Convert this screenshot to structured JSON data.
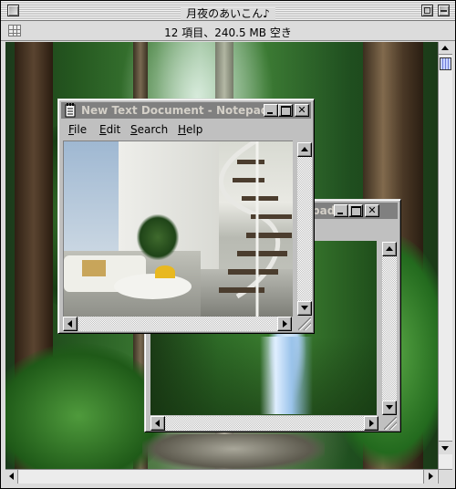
{
  "mac_window": {
    "title": "月夜のあいこん♪",
    "info": "12 項目、240.5 MB 空き"
  },
  "front_window": {
    "title": "New Text Document - Notepad",
    "menu": [
      "File",
      "Edit",
      "Search",
      "Help"
    ],
    "close_glyph": "✕"
  },
  "back_window": {
    "title_fragment": "pad",
    "close_glyph": "✕"
  },
  "icons": [
    "grid-icon",
    "notepad-icon",
    "minimize-icon",
    "maximize-icon",
    "close-icon",
    "scroll-arrow-icons",
    "resize-grip-icon"
  ],
  "colors": {
    "mac_chrome": "#dcdcdc",
    "win_chrome": "#c0c0c0",
    "inactive_titlebar": "#808080",
    "scroll_thumb": "#6e7dd8"
  }
}
